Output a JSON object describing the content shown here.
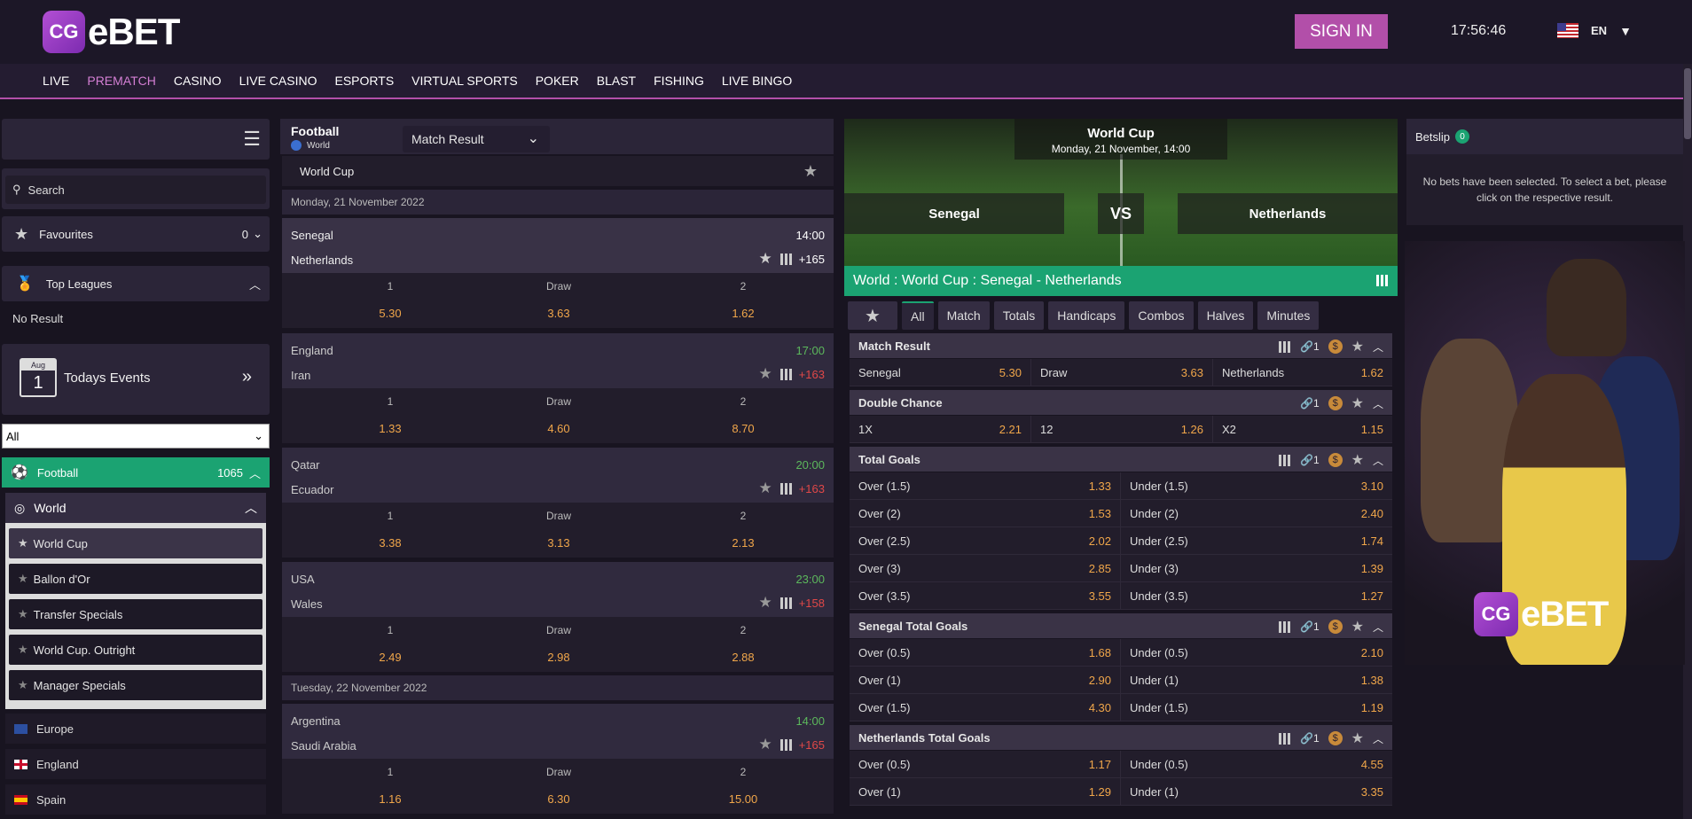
{
  "brand": {
    "logo_mark": "CG",
    "logo_text": "eBET"
  },
  "header": {
    "sign_in": "SIGN IN",
    "time": "17:56:46",
    "lang": "EN"
  },
  "nav": [
    "LIVE",
    "PREMATCH",
    "CASINO",
    "LIVE CASINO",
    "ESPORTS",
    "VIRTUAL SPORTS",
    "POKER",
    "BLAST",
    "FISHING",
    "LIVE BINGO"
  ],
  "sidebar": {
    "search_placeholder": "Search",
    "favourites": {
      "label": "Favourites",
      "count": "0"
    },
    "top_leagues": {
      "label": "Top Leagues",
      "empty": "No Result"
    },
    "todays_events": {
      "label": "Todays Events",
      "month": "Aug",
      "day": "1"
    },
    "filter_value": "All",
    "sport": {
      "label": "Football",
      "count": "1065"
    },
    "region": {
      "label": "World"
    },
    "sub_items": [
      "World Cup",
      "Ballon d'Or",
      "Transfer Specials",
      "World Cup. Outright",
      "Manager Specials"
    ],
    "countries": [
      "Europe",
      "England",
      "Spain"
    ]
  },
  "events": {
    "sport": "Football",
    "region": "World",
    "market_select": "Match Result",
    "league": "World Cup",
    "date1": "Monday, 21 November 2022",
    "date2": "Tuesday, 22 November 2022",
    "outcome_labels": [
      "1",
      "Draw",
      "2"
    ],
    "matches": [
      {
        "home": "Senegal",
        "away": "Netherlands",
        "time": "14:00",
        "more": "+165",
        "odds": [
          "5.30",
          "3.63",
          "1.62"
        ]
      },
      {
        "home": "England",
        "away": "Iran",
        "time": "17:00",
        "more": "+163",
        "odds": [
          "1.33",
          "4.60",
          "8.70"
        ]
      },
      {
        "home": "Qatar",
        "away": "Ecuador",
        "time": "20:00",
        "more": "+163",
        "odds": [
          "3.38",
          "3.13",
          "2.13"
        ]
      },
      {
        "home": "USA",
        "away": "Wales",
        "time": "23:00",
        "more": "+158",
        "odds": [
          "2.49",
          "2.98",
          "2.88"
        ]
      },
      {
        "home": "Argentina",
        "away": "Saudi Arabia",
        "time": "14:00",
        "more": "+165",
        "odds": [
          "1.16",
          "6.30",
          "15.00"
        ]
      }
    ]
  },
  "detail": {
    "competition": "World Cup",
    "datetime": "Monday, 21 November, 14:00",
    "home": "Senegal",
    "vs": "VS",
    "away": "Netherlands",
    "breadcrumb": "World : World Cup : Senegal - Netherlands",
    "tabs": [
      "All",
      "Match",
      "Totals",
      "Handicaps",
      "Combos",
      "Halves",
      "Minutes"
    ],
    "markets": {
      "match_result": {
        "title": "Match Result",
        "count": "1",
        "row": [
          [
            "Senegal",
            "5.30"
          ],
          [
            "Draw",
            "3.63"
          ],
          [
            "Netherlands",
            "1.62"
          ]
        ]
      },
      "double_chance": {
        "title": "Double Chance",
        "count": "1",
        "row": [
          [
            "1X",
            "2.21"
          ],
          [
            "12",
            "1.26"
          ],
          [
            "X2",
            "1.15"
          ]
        ]
      },
      "total_goals": {
        "title": "Total Goals",
        "count": "1",
        "rows": [
          [
            "Over (1.5)",
            "1.33",
            "Under (1.5)",
            "3.10"
          ],
          [
            "Over (2)",
            "1.53",
            "Under (2)",
            "2.40"
          ],
          [
            "Over (2.5)",
            "2.02",
            "Under (2.5)",
            "1.74"
          ],
          [
            "Over (3)",
            "2.85",
            "Under (3)",
            "1.39"
          ],
          [
            "Over (3.5)",
            "3.55",
            "Under (3.5)",
            "1.27"
          ]
        ]
      },
      "senegal_total": {
        "title": "Senegal Total Goals",
        "count": "1",
        "rows": [
          [
            "Over (0.5)",
            "1.68",
            "Under (0.5)",
            "2.10"
          ],
          [
            "Over (1)",
            "2.90",
            "Under (1)",
            "1.38"
          ],
          [
            "Over (1.5)",
            "4.30",
            "Under (1.5)",
            "1.19"
          ]
        ]
      },
      "netherlands_total": {
        "title": "Netherlands Total Goals",
        "count": "1",
        "rows": [
          [
            "Over (0.5)",
            "1.17",
            "Under (0.5)",
            "4.55"
          ],
          [
            "Over (1)",
            "1.29",
            "Under (1)",
            "3.35"
          ]
        ]
      }
    }
  },
  "betslip": {
    "title": "Betslip",
    "count": "0",
    "empty_text": "No bets have been selected. To select a bet, please click on the respective result."
  },
  "colors": {
    "accent": "#b24fa9",
    "green": "#1ba372",
    "odds": "#f0a64a",
    "bg": "#181420"
  }
}
